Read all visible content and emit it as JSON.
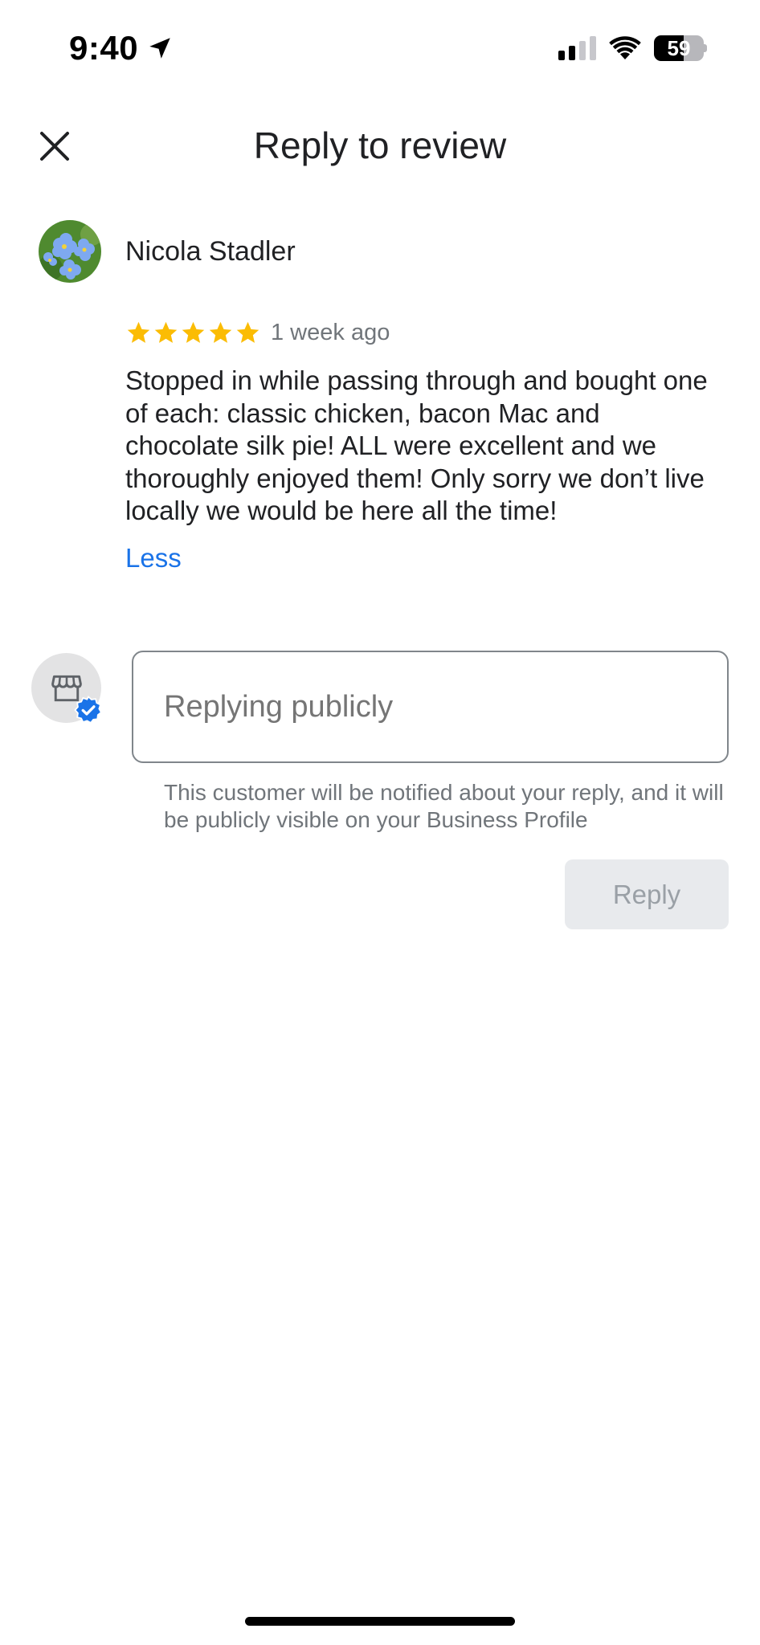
{
  "status_bar": {
    "time": "9:40",
    "battery_percent": "59",
    "battery_level": 0.59,
    "signal_bars_active": 2,
    "signal_bars_total": 4
  },
  "header": {
    "title": "Reply to review",
    "close_icon": "close-icon"
  },
  "review": {
    "reviewer_name": "Nicola Stadler",
    "rating": 5,
    "max_rating": 5,
    "time_ago": "1 week ago",
    "text": "Stopped in while passing through and bought one of each: classic chicken, bacon Mac and chocolate silk pie! ALL were excellent and we thoroughly enjoyed them! Only sorry we don’t live locally we would be here all the time!",
    "collapse_label": "Less"
  },
  "reply": {
    "input_value": "",
    "placeholder": "Replying publicly",
    "notice": "This customer will be notified about your reply, and it will be publicly visible on your Business Profile",
    "button_label": "Reply",
    "business_icon": "storefront-icon",
    "verified_icon": "verified-badge-icon"
  },
  "colors": {
    "star": "#fbbc04",
    "link": "#1a73e8",
    "verified": "#1a73e8",
    "button_bg_disabled": "#e8eaed",
    "button_text_disabled": "#9aa0a6"
  }
}
